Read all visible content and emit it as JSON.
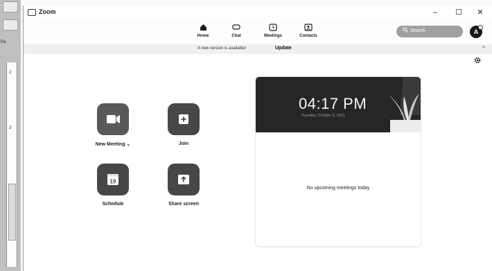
{
  "background": {
    "left_strip_labels": [
      "Pa",
      "2",
      "3"
    ]
  },
  "window": {
    "title": "Zoom",
    "controls": {
      "minimize": "–",
      "maximize": "☐",
      "close": "✕"
    }
  },
  "toolbar": {
    "tabs": [
      {
        "label": "Home",
        "icon": "home-icon",
        "active": true
      },
      {
        "label": "Chat",
        "icon": "chat-icon",
        "active": false
      },
      {
        "label": "Meetings",
        "icon": "meetings-clock-icon",
        "active": false
      },
      {
        "label": "Contacts",
        "icon": "contacts-icon",
        "active": false
      }
    ],
    "search_placeholder": "Search",
    "avatar_initial": "A"
  },
  "banner": {
    "message": "A new version is available!",
    "update_link": "Update",
    "close": "^"
  },
  "actions": [
    {
      "label": "New Meeting",
      "suffix": "⌄",
      "icon": "video-camera-icon"
    },
    {
      "label": "Join",
      "icon": "plus-icon"
    },
    {
      "label": "Schedule",
      "icon": "calendar-icon",
      "calendar_day": "19"
    },
    {
      "label": "Share screen",
      "icon": "share-screen-icon"
    }
  ],
  "calendar_card": {
    "time": "04:17 PM",
    "date": "Tuesday, October 5, 2021",
    "empty_message": "No upcoming meetings today"
  },
  "colors": {
    "dark_button": "#4a4a4a",
    "card_header": "#2a2a2a",
    "search_pill": "#9e9e9e"
  }
}
